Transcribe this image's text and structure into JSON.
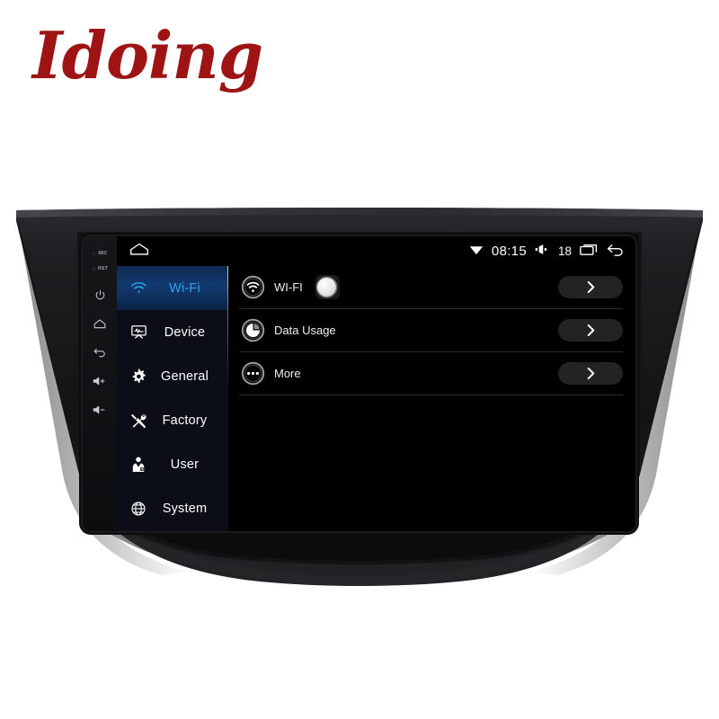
{
  "brand": {
    "name": "Idoing"
  },
  "device": {
    "hw_buttons": [
      {
        "name": "mic",
        "label": "MIC",
        "type": "led"
      },
      {
        "name": "reset",
        "label": "RST",
        "type": "led"
      },
      {
        "name": "power",
        "label": "",
        "type": "icon"
      },
      {
        "name": "home",
        "label": "",
        "type": "icon"
      },
      {
        "name": "back",
        "label": "",
        "type": "icon"
      },
      {
        "name": "volume-up",
        "label": "+",
        "type": "icon"
      },
      {
        "name": "volume-down",
        "label": "-",
        "type": "icon"
      }
    ]
  },
  "statusbar": {
    "home_icon": "home-icon",
    "wifi_icon": "wifi-signal-icon",
    "clock": "08:15",
    "volume_icon": "volume-icon",
    "volume_level": "18",
    "recents_icon": "recent-apps-icon",
    "back_icon": "back-arrow-icon"
  },
  "sidebar": {
    "items": [
      {
        "label": "Wi-Fi",
        "icon": "wifi-icon",
        "selected": true
      },
      {
        "label": "Device",
        "icon": "display-icon",
        "selected": false
      },
      {
        "label": "General",
        "icon": "gear-icon",
        "selected": false
      },
      {
        "label": "Factory",
        "icon": "tools-icon",
        "selected": false
      },
      {
        "label": "User",
        "icon": "user-icon",
        "selected": false
      },
      {
        "label": "System",
        "icon": "globe-icon",
        "selected": false
      }
    ]
  },
  "content": {
    "rows": [
      {
        "label": "WI-FI",
        "icon": "wifi-circle-icon",
        "toggle": true,
        "toggle_on": false,
        "chevron": "chevron-right-icon"
      },
      {
        "label": "Data Usage",
        "icon": "data-usage-icon",
        "toggle": false,
        "toggle_on": false,
        "chevron": "chevron-right-icon"
      },
      {
        "label": "More",
        "icon": "more-dots-icon",
        "toggle": false,
        "toggle_on": false,
        "chevron": "chevron-right-icon"
      }
    ]
  },
  "colors": {
    "brand": "#9e1313",
    "accent": "#2aa3f0",
    "sidebar_bg": "#0b0e16",
    "selected_bg": "#123a70",
    "screen_bg": "#000000",
    "bezel": "#1a1a1c"
  }
}
